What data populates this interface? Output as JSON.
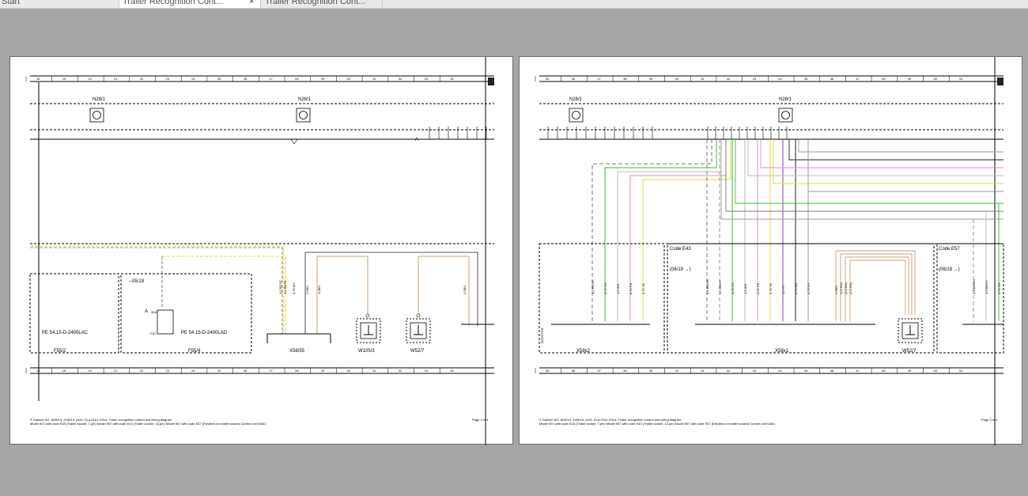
{
  "tabs": [
    {
      "label": "Start"
    },
    {
      "label": "Trailer Recognition Cont..."
    },
    {
      "label": "Trailer Recognition Cont..."
    }
  ],
  "tab_close_glyph": "×",
  "pages": [
    {
      "grid_numbers": [
        "18",
        "19",
        "20",
        "21",
        "22",
        "23",
        "24",
        "25",
        "26",
        "27",
        "28",
        "29",
        "30",
        "31",
        "32",
        "33",
        "34"
      ],
      "module_labels": [
        "N28/1",
        "N28/1"
      ],
      "code_label": "05/19",
      "component_labels": [
        "PE 54.15-D-2400LAC",
        "PE 54.15-D-2400LAD",
        "F55/2",
        "F55/4",
        "X58/55",
        "W105/3",
        "W52/7"
      ],
      "wire_labels": [
        "4,0 RDYE",
        "4,0 RDYE",
        "0,75 BU",
        "2,5BU",
        "4,0BN",
        "2,5BN"
      ],
      "fuse_labels": [
        "30A",
        "F32"
      ],
      "marker_a": "A",
      "footer_line1": "© Daimler AG, 8/05/19, X/08/19, ps31.19-d-2101-97tus, Trailer recognition control unit wiring diagram",
      "footer_line2": "Model 907 with code E40 (Trailer socket, 7-pin) Model 907 with code E43 (Trailer socket, 13-pin) Model 907 with code E57 (Electrics for trailer socket) Control unit N28/1",
      "page_number": "Page 2 of 4"
    },
    {
      "grid_numbers": [
        "35",
        "36",
        "37",
        "38",
        "39",
        "40",
        "41",
        "42",
        "43",
        "44",
        "45",
        "46",
        "47",
        "48",
        "49",
        "50",
        "51"
      ],
      "module_labels": [
        "N28/1",
        "N28/1"
      ],
      "code_labels": [
        "Code E43",
        "Code E57"
      ],
      "date_labels": [
        "(06/19 →)",
        "(06/19 →)"
      ],
      "component_labels": [
        "X58x2",
        "X58x1",
        "W52/7",
        "BOOSTER"
      ],
      "wire_labels_left": [
        "1,5 RDGY",
        "0,75 GN",
        "1,5 WH",
        "0,75 PK",
        "0,75 YE"
      ],
      "wire_labels_mid": [
        "1,5 BKWH",
        "1,5 RDGY",
        "0,75 GN",
        "1,5 WH",
        "0,75 PK",
        "0,75 YE",
        "1,5 VT",
        "0,75 BU",
        "0,75 GY"
      ],
      "wire_labels_right": [
        "2,5BN",
        "(2,5 BN)",
        "(2,5 BN)",
        "(2,5 BN)"
      ],
      "wire_labels_far": [
        "1,5 BKWH",
        "1,5 RDGY",
        "0,75 GN"
      ],
      "footer_line1": "© Daimler AG, 8/05/19, X/08/19, ps31.19-d-2101-97tus, Trailer recognition control unit wiring diagram",
      "footer_line2": "Model 907 with code E40 (Trailer socket, 7-pin) Model 907 with code E43 (Trailer socket, 13-pin) Model 907 with code E57 (Electrics for trailer socket) Control unit N28/1",
      "page_number": "Page 3 of 4"
    }
  ],
  "colors": {
    "viewer_bg": "#a6a6a6",
    "wire_green": "#35c335",
    "wire_pink": "#d98ad9",
    "wire_yellow": "#e8e030",
    "wire_violet": "#8a3aa8",
    "wire_brown": "#c8a070",
    "wire_grey": "#9a9a9a",
    "wire_black": "#222222"
  }
}
